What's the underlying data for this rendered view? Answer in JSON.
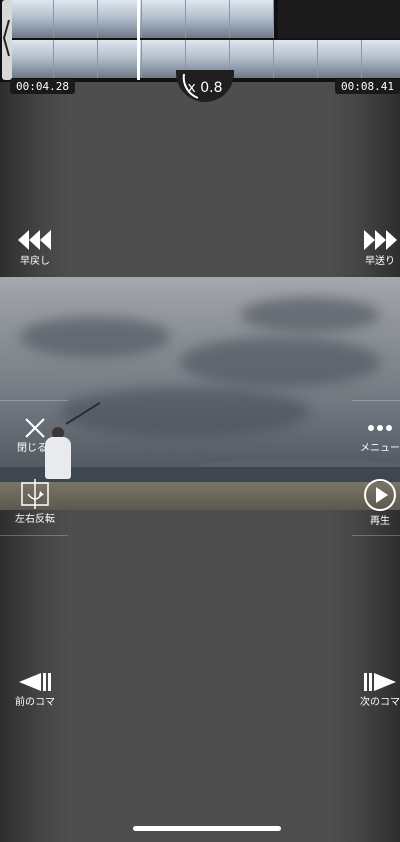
{
  "timeline": {
    "current_time": "00:04.28",
    "end_time": "00:08.41",
    "speed_label": "x 0.8"
  },
  "controls": {
    "rewind_label": "早戻し",
    "fast_forward_label": "早送り",
    "close_label": "閉じる",
    "menu_label": "メニュー",
    "mirror_label": "左右反転",
    "play_label": "再生",
    "prev_frame_label": "前のコマ",
    "next_frame_label": "次のコマ"
  },
  "icons": {
    "rewind": "rewind-icon",
    "fast_forward": "fast-forward-icon",
    "close": "close-icon",
    "menu": "more-horizontal-icon",
    "mirror": "mirror-flip-icon",
    "play": "play-circle-icon",
    "prev_frame": "previous-frame-icon",
    "next_frame": "next-frame-icon"
  },
  "colors": {
    "background": "#4e4e4e",
    "timeline_bg": "#111111",
    "text": "#ffffff"
  }
}
